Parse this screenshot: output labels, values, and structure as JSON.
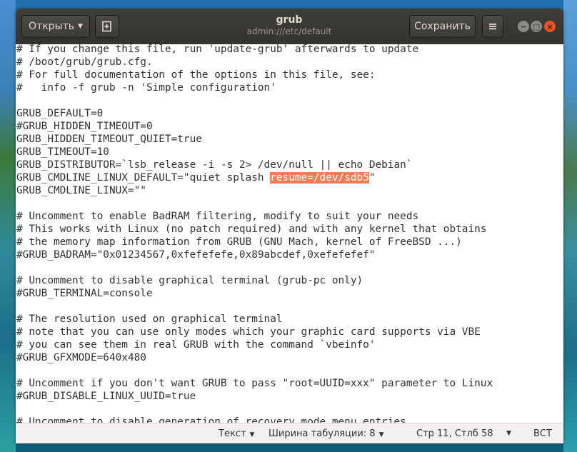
{
  "header": {
    "open_label": "Открыть",
    "title": "grub",
    "subtitle": "admin:///etc/default",
    "save_label": "Сохранить"
  },
  "editor": {
    "selection_text": "resume=/dev/sdb5",
    "lines": [
      "# If you change this file, run 'update-grub' afterwards to update",
      "# /boot/grub/grub.cfg.",
      "# For full documentation of the options in this file, see:",
      "#   info -f grub -n 'Simple configuration'",
      "",
      "GRUB_DEFAULT=0",
      "#GRUB_HIDDEN_TIMEOUT=0",
      "GRUB_HIDDEN_TIMEOUT_QUIET=true",
      "GRUB_TIMEOUT=10",
      "GRUB_DISTRIBUTOR=`lsb_release -i -s 2> /dev/null || echo Debian`",
      "GRUB_CMDLINE_LINUX_DEFAULT=\"quiet splash resume=/dev/sdb5\"",
      "GRUB_CMDLINE_LINUX=\"\"",
      "",
      "# Uncomment to enable BadRAM filtering, modify to suit your needs",
      "# This works with Linux (no patch required) and with any kernel that obtains",
      "# the memory map information from GRUB (GNU Mach, kernel of FreeBSD ...)",
      "#GRUB_BADRAM=\"0x01234567,0xfefefefe,0x89abcdef,0xefefefef\"",
      "",
      "# Uncomment to disable graphical terminal (grub-pc only)",
      "#GRUB_TERMINAL=console",
      "",
      "# The resolution used on graphical terminal",
      "# note that you can use only modes which your graphic card supports via VBE",
      "# you can see them in real GRUB with the command `vbeinfo'",
      "#GRUB_GFXMODE=640x480",
      "",
      "# Uncomment if you don't want GRUB to pass \"root=UUID=xxx\" parameter to Linux",
      "#GRUB_DISABLE_LINUX_UUID=true",
      "",
      "# Uncomment to disable generation of recovery mode menu entries"
    ]
  },
  "statusbar": {
    "language": "Текст",
    "tab_width": "Ширина табуляции: 8",
    "position": "Стр 11, Стлб 58",
    "mode": "ВСТ"
  }
}
